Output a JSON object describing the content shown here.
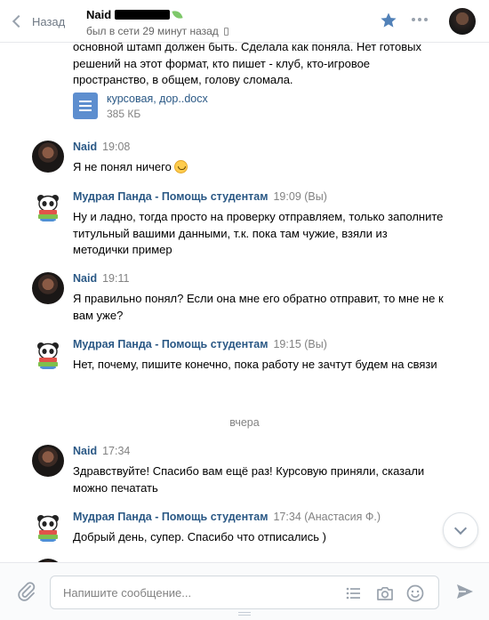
{
  "header": {
    "back_label": "Назад",
    "peer_name": "Naid",
    "peer_status": "был в сети 29 минут назад"
  },
  "attachment": {
    "name": "курсовая, дор..docx",
    "size": "385 КБ"
  },
  "messages": [
    {
      "text": "основной штамп должен быть. Сделала как поняла. Нет готовых решений на этот формат, кто пишет - клуб, кто-игровое пространство, в общем, голову сломала."
    },
    {
      "author": "Naid",
      "time": "19:08",
      "text": "Я не понял ничего"
    },
    {
      "author": "Мудрая Панда - Помощь студентам",
      "time": "19:09 (Вы)",
      "text": "Ну и ладно, тогда просто на проверку отправляем, только заполните титульный вашими данными, т.к. пока там чужие, взяли из методички пример"
    },
    {
      "author": "Naid",
      "time": "19:11",
      "text": "Я правильно понял? Если она мне его обратно отправит, то мне не к вам уже?"
    },
    {
      "author": "Мудрая Панда - Помощь студентам",
      "time": "19:15 (Вы)",
      "text": "Нет, почему, пишите конечно, пока работу не зачтут будем на связи"
    },
    {
      "author": "Naid",
      "time": "17:34",
      "text": "Здравствуйте! Спасибо вам ещё раз! Курсовую приняли, сказали можно печатать"
    },
    {
      "author": "Мудрая Панда - Помощь студентам",
      "time": "17:34 (Анастасия Ф.)",
      "text": "Добрый день, супер. Спасибо что отписались )"
    }
  ],
  "date_divider": "вчера",
  "composer": {
    "placeholder": "Напишите сообщение..."
  },
  "colors": {
    "accent": "#2a5885",
    "star": "#5181b8",
    "doc_icon": "#5d8ecf"
  },
  "icons": [
    "chevron-left-icon",
    "star-icon",
    "more-icon",
    "document-icon",
    "paperclip-icon",
    "list-icon",
    "camera-icon",
    "smile-icon",
    "send-icon",
    "chevron-down-icon"
  ]
}
